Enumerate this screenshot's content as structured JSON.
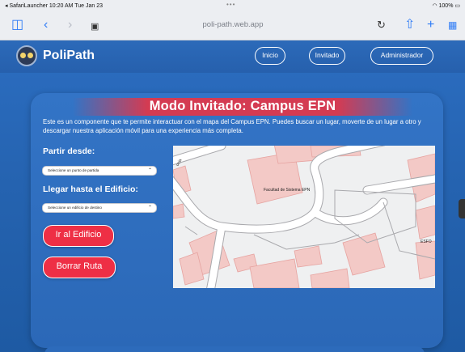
{
  "status_bar": {
    "left": "◂ SafariLauncher  10:20 AM  Tue Jan 23",
    "dots": "•••",
    "right": "100%"
  },
  "browser": {
    "url": "poli-path.web.app",
    "icons": [
      "sidebar-icon",
      "back-icon",
      "forward-icon",
      "reader-icon",
      "reload-icon",
      "share-icon",
      "new-tab-icon",
      "tabs-icon"
    ]
  },
  "header": {
    "brand": "PoliPath",
    "nav": [
      {
        "label": "Inicio"
      },
      {
        "label": "Invitado"
      },
      {
        "label": "Administrador"
      }
    ]
  },
  "main": {
    "title": "Modo Invitado: Campus EPN",
    "description": "Este es un componente que te permite interactuar con el mapa del Campus EPN. Puedes buscar un lugar, moverte de un lugar a otro y descargar nuestra aplicación móvil para una experiencia más completa.",
    "from_label": "Partir desde:",
    "from_select": "Seleccione un punto de partida",
    "to_label": "Llegar hasta el Edificio:",
    "to_select": "Seleccione un edificio de destino",
    "go_button": "Ir al Edificio",
    "clear_button": "Borrar Ruta"
  },
  "map": {
    "labels": {
      "street": "ocia",
      "building": "Facultad de Sistema EPN",
      "right": "ESFO"
    },
    "colors": {
      "building": "#f3c9c6",
      "building_stroke": "#e6a3a0",
      "road": "#ffffff",
      "road_stroke": "#a9a9ad",
      "background": "#eff0f1"
    }
  },
  "colors": {
    "header_blue": "#2a66b7",
    "accent_red": "#ee2f45",
    "title_band": "#d43b52"
  }
}
